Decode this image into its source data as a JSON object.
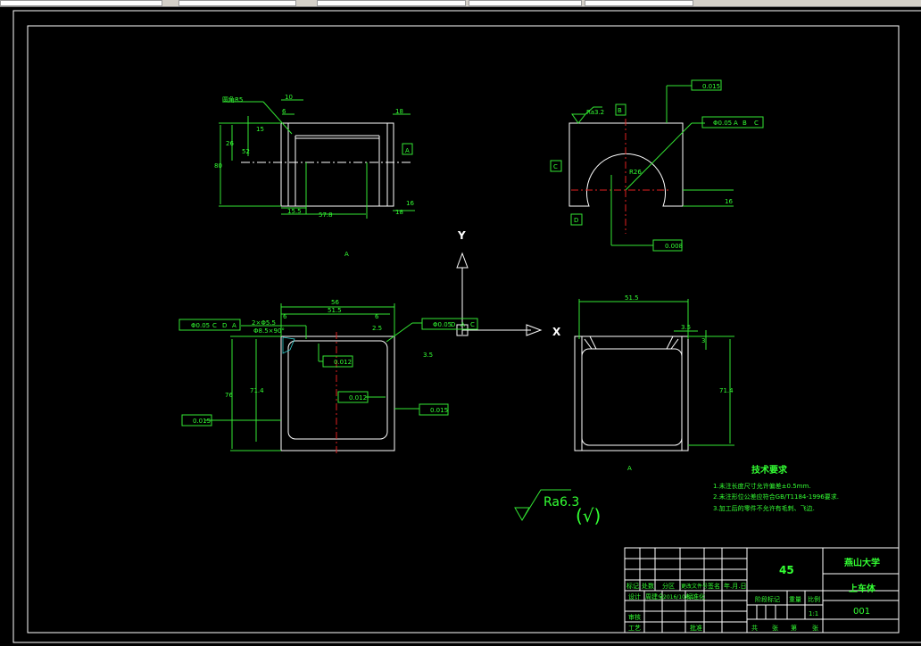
{
  "toolbar": {
    "fields": [
      "",
      "",
      "",
      "",
      ""
    ]
  },
  "colors": {
    "background": "#000000",
    "geometry": "#ffffff",
    "dimension": "#33e633",
    "centerline": "#e02020"
  },
  "views": {
    "top_view": {
      "dims": [
        "10",
        "6",
        "15",
        "80",
        "26",
        "52",
        "18",
        "18",
        "16",
        "15.5",
        "57.8"
      ],
      "note": "圆角R5",
      "datum": "A",
      "label": "A"
    },
    "side_view": {
      "roughness": "Ra3.2",
      "datum_top": "B",
      "datum_left": "C",
      "datum_bottom": "D",
      "flatness": "0.015",
      "position": "Φ0.05",
      "position_refs": [
        "A",
        "B",
        "C"
      ],
      "circularity": "0.008",
      "radius": "R26",
      "dim_right": "16"
    },
    "front_view": {
      "dims": [
        "56",
        "51.5",
        "6",
        "6",
        "2.5",
        "3.5",
        "76",
        "71.4"
      ],
      "chamfer": "2×Φ5.5",
      "counterbore": "Φ8.5×90°",
      "position_left": "Φ0.05",
      "position_left_refs": [
        "C",
        "D",
        "A"
      ],
      "position_right": "Φ0.05",
      "position_right_refs": [
        "D",
        "A",
        "C"
      ],
      "flatness": [
        "0.012",
        "0.012",
        "0.015",
        "0.015"
      ]
    },
    "rear_view": {
      "dims": [
        "51.5",
        "3.5",
        "3",
        "71.4"
      ],
      "label": "A"
    }
  },
  "axes": {
    "x": "X",
    "y": "Y"
  },
  "surface_finish": {
    "value": "Ra6.3",
    "other": "(√)"
  },
  "tech_requirements": {
    "title": "技术要求",
    "items": [
      "1.未注长度尺寸允许偏差±0.5mm.",
      "2.未注形位公差应符合GB/T1184-1996要求.",
      "3.加工后的零件不允许有毛刺、飞边."
    ]
  },
  "title_block": {
    "material": "45",
    "school": "燕山大学",
    "part_name": "上车体",
    "drawing_no": "001",
    "headers": [
      "标记",
      "处数",
      "分区",
      "更改文件号",
      "签名",
      "年.月.日"
    ],
    "design": "设计",
    "designer": "周建全",
    "date": "2016/10/11",
    "standardize": "标准化",
    "review": "审核",
    "process": "工艺",
    "approve": "批准",
    "stage_mark": "阶段标记",
    "weight": "重量",
    "scale_label": "比例",
    "scale": "1:1",
    "sheets": [
      "共",
      "张",
      "第",
      "张"
    ]
  }
}
